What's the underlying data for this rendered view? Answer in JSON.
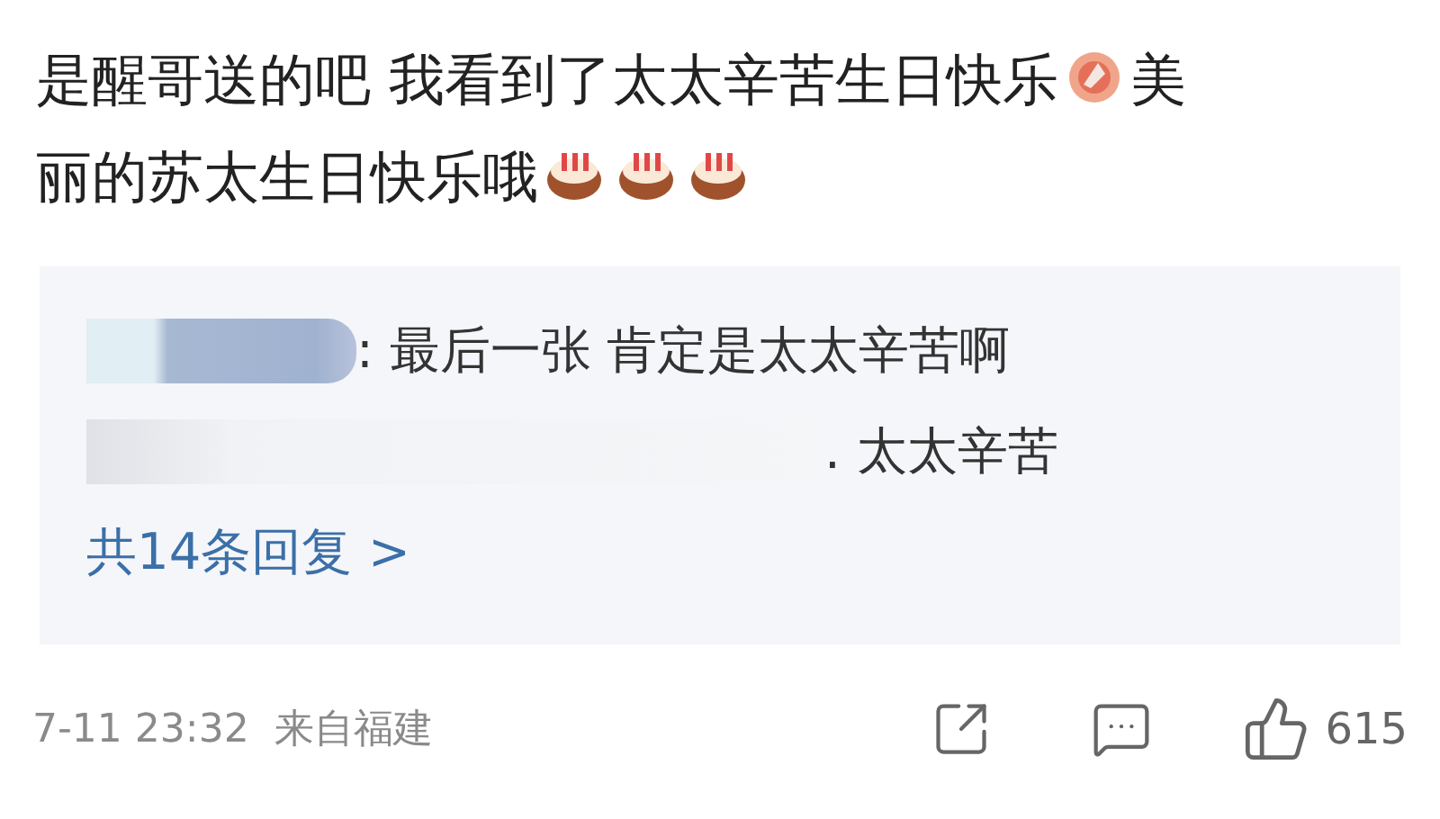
{
  "comment": {
    "lines": [
      [
        {
          "kind": "text",
          "text": "是醒哥送的吧 我看到了太太辛苦生日快乐"
        },
        {
          "kind": "flower"
        },
        {
          "kind": "text",
          "text": "美"
        }
      ],
      [
        {
          "kind": "text",
          "text": "丽的苏太生日快乐哦"
        },
        {
          "kind": "cake"
        },
        {
          "kind": "cake"
        },
        {
          "kind": "cake"
        }
      ]
    ]
  },
  "replies": {
    "lines": [
      [
        {
          "kind": "redacted_short"
        },
        {
          "kind": "text",
          "text": ": 最后一张 肯定是太太辛苦啊"
        }
      ],
      [
        {
          "kind": "redacted_long"
        },
        {
          "kind": "text",
          "text": ". 太太辛苦"
        }
      ]
    ],
    "more": "共14条回复 >"
  },
  "footer": {
    "time": "7-11 23:32",
    "source": "来自福建",
    "likes": "615"
  }
}
